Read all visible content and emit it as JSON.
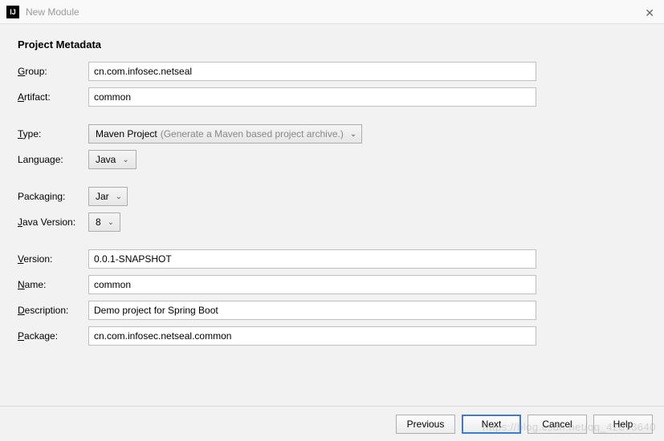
{
  "window": {
    "title": "New Module",
    "app_icon_text": "IJ"
  },
  "heading": "Project Metadata",
  "labels": {
    "group": "Group:",
    "artifact": "Artifact:",
    "type": "Type:",
    "language": "Language:",
    "packaging": "Packaging:",
    "java_version": "Java Version:",
    "version": "Version:",
    "name": "Name:",
    "description": "Description:",
    "package": "Package:"
  },
  "values": {
    "group": "cn.com.infosec.netseal",
    "artifact": "common",
    "type": "Maven Project",
    "type_hint": "(Generate a Maven based project archive.)",
    "language": "Java",
    "packaging": "Jar",
    "java_version": "8",
    "version": "0.0.1-SNAPSHOT",
    "name": "common",
    "description": "Demo project for Spring Boot",
    "package": "cn.com.infosec.netseal.common"
  },
  "buttons": {
    "previous": "Previous",
    "next": "Next",
    "cancel": "Cancel",
    "help": "Help"
  },
  "watermark": "https://blog.csdn.net/qq_42873640"
}
